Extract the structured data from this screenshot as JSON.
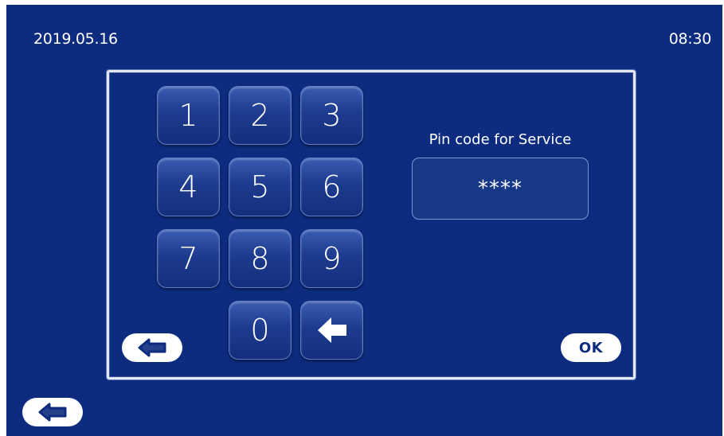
{
  "status_bar": {
    "date": "2019.05.16",
    "time": "08:30"
  },
  "keypad": {
    "keys": [
      "1",
      "2",
      "3",
      "4",
      "5",
      "6",
      "7",
      "8",
      "9",
      "0"
    ],
    "backspace_icon": "arrow-left-icon"
  },
  "pin": {
    "label": "Pin code for Service",
    "value": "****"
  },
  "buttons": {
    "ok_label": "OK",
    "back_icon": "arrow-left-icon"
  },
  "colors": {
    "background": "#0d2c7f",
    "key_gradient_top": "#3a5cb1",
    "key_gradient_bottom": "#142e7c",
    "panel_border": "#e4e8f2",
    "text": "#ffffff"
  }
}
